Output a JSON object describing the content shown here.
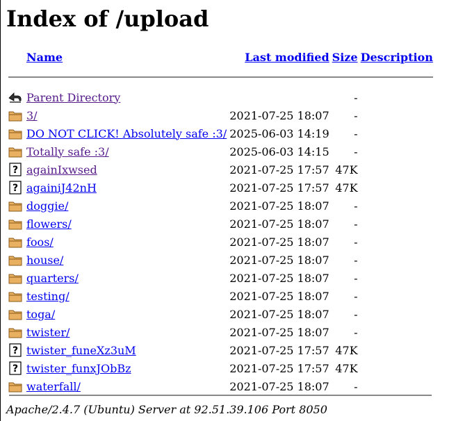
{
  "title": "Index of /upload",
  "columns": {
    "name": "Name",
    "modified": "Last modified",
    "size": "Size",
    "description": "Description"
  },
  "parent": {
    "label": "Parent Directory",
    "size": "-"
  },
  "entries": [
    {
      "icon": "folder-icon",
      "name": "3/",
      "modified": "2021-07-25 18:07",
      "size": "-",
      "visited": true
    },
    {
      "icon": "folder-icon",
      "name": "DO NOT CLICK! Absolutely safe :3/",
      "modified": "2025-06-03 14:19",
      "size": "-",
      "visited": false
    },
    {
      "icon": "folder-icon",
      "name": "Totally safe :3/",
      "modified": "2025-06-03 14:15",
      "size": "-",
      "visited": true
    },
    {
      "icon": "unknown-file-icon",
      "name": "againIxwsed",
      "modified": "2021-07-25 17:57",
      "size": "47K",
      "visited": true
    },
    {
      "icon": "unknown-file-icon",
      "name": "againiJ42nH",
      "modified": "2021-07-25 17:57",
      "size": "47K",
      "visited": false
    },
    {
      "icon": "folder-icon",
      "name": "doggie/",
      "modified": "2021-07-25 18:07",
      "size": "-",
      "visited": false
    },
    {
      "icon": "folder-icon",
      "name": "flowers/",
      "modified": "2021-07-25 18:07",
      "size": "-",
      "visited": false
    },
    {
      "icon": "folder-icon",
      "name": "foos/",
      "modified": "2021-07-25 18:07",
      "size": "-",
      "visited": false
    },
    {
      "icon": "folder-icon",
      "name": "house/",
      "modified": "2021-07-25 18:07",
      "size": "-",
      "visited": false
    },
    {
      "icon": "folder-icon",
      "name": "quarters/",
      "modified": "2021-07-25 18:07",
      "size": "-",
      "visited": false
    },
    {
      "icon": "folder-icon",
      "name": "testing/",
      "modified": "2021-07-25 18:07",
      "size": "-",
      "visited": false
    },
    {
      "icon": "folder-icon",
      "name": "toga/",
      "modified": "2021-07-25 18:07",
      "size": "-",
      "visited": false
    },
    {
      "icon": "folder-icon",
      "name": "twister/",
      "modified": "2021-07-25 18:07",
      "size": "-",
      "visited": false
    },
    {
      "icon": "unknown-file-icon",
      "name": "twister_funeXz3uM",
      "modified": "2021-07-25 17:57",
      "size": "47K",
      "visited": false
    },
    {
      "icon": "unknown-file-icon",
      "name": "twister_funxJObBz",
      "modified": "2021-07-25 17:57",
      "size": "47K",
      "visited": false
    },
    {
      "icon": "folder-icon",
      "name": "waterfall/",
      "modified": "2021-07-25 18:07",
      "size": "-",
      "visited": false
    }
  ],
  "footer": "Apache/2.4.7 (Ubuntu) Server at 92.51.39.106 Port 8050",
  "colors": {
    "link": "#0000ee",
    "visited": "#551a8b",
    "rule": "#888888"
  }
}
